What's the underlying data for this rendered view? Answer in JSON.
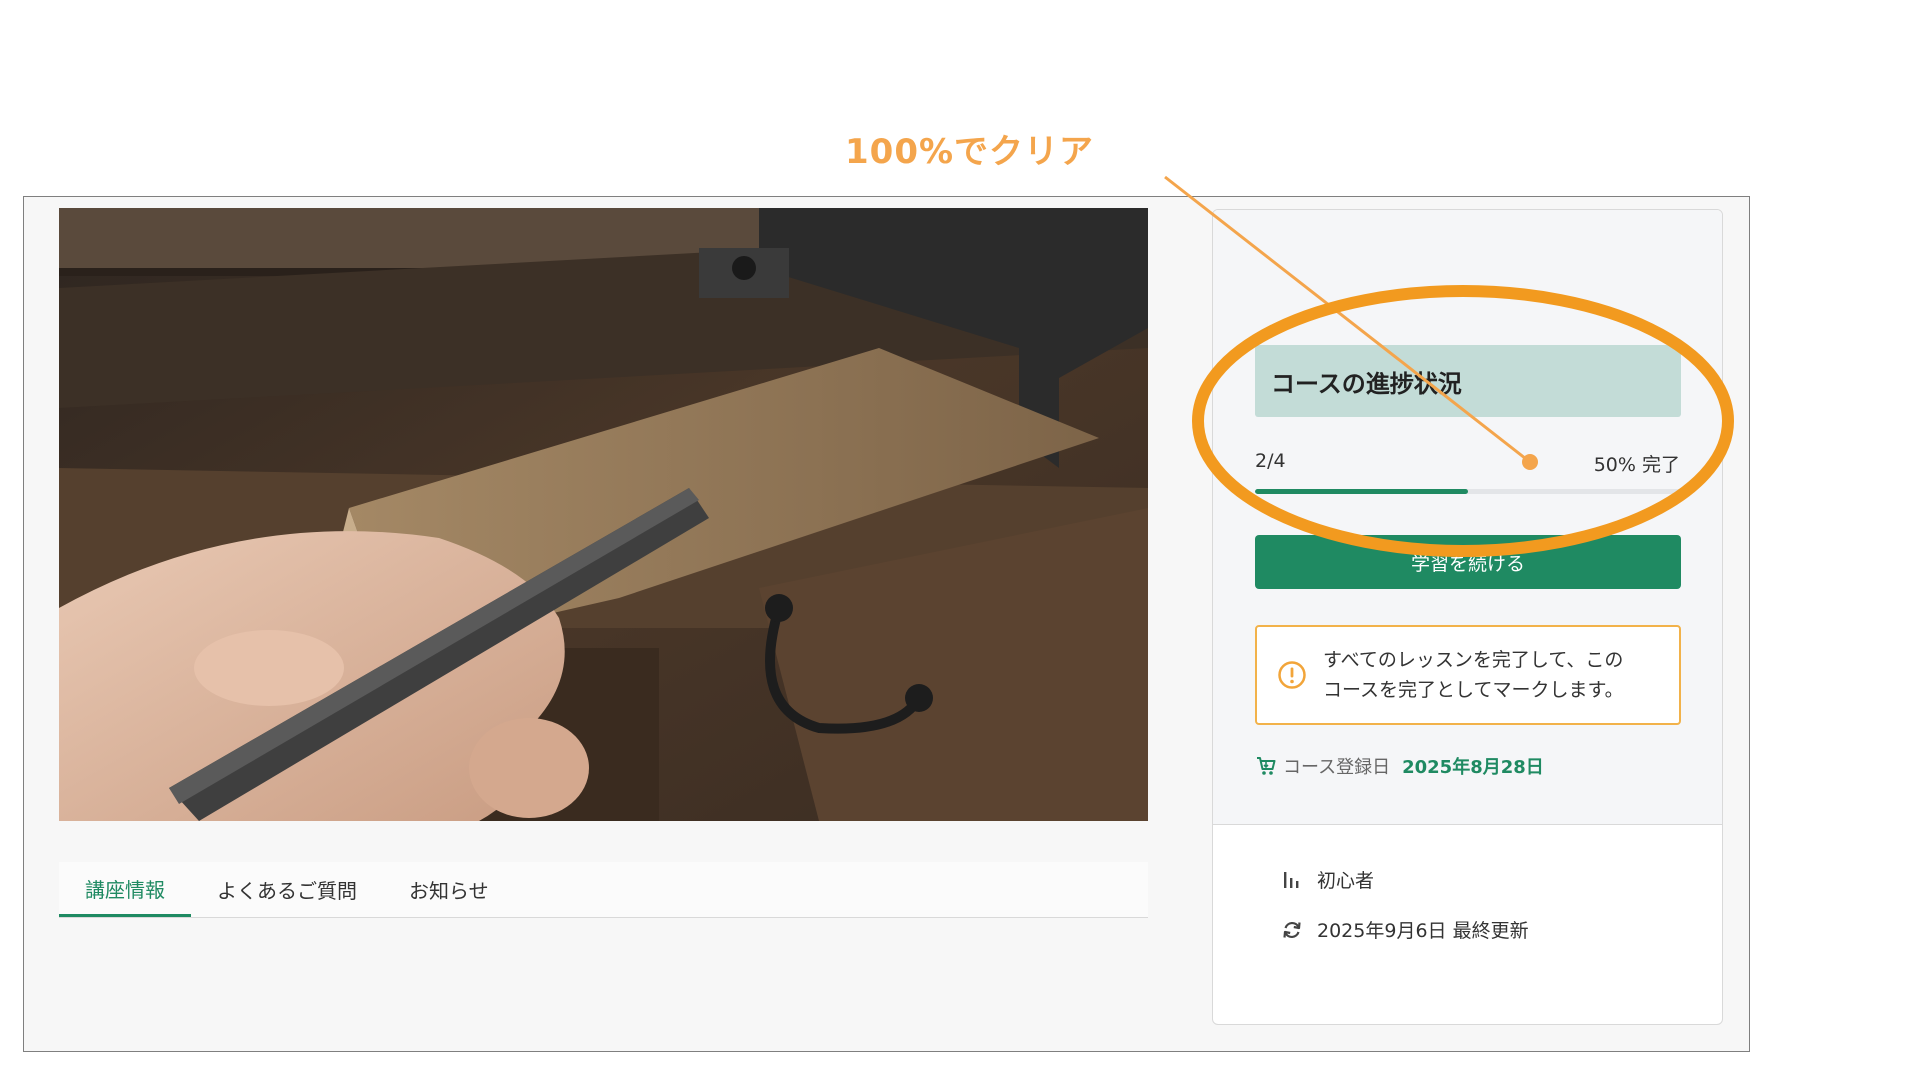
{
  "annotation": {
    "label": "100%でクリア",
    "color": "#f29a1f"
  },
  "media": {
    "description_icon": "wooden-board-file-photo"
  },
  "tabs": [
    {
      "label": "講座情報",
      "active": true
    },
    {
      "label": "よくあるご質問",
      "active": false
    },
    {
      "label": "お知らせ",
      "active": false
    }
  ],
  "sidebar": {
    "progress_title": "コースの進捗状況",
    "progress_count": "2/4",
    "progress_percent_text": "50% 完了",
    "progress_fraction": 0.5,
    "continue_label": "学習を続ける",
    "notice_icon": "warning-circle-icon",
    "notice_text_line1": "すべてのレッスンを完了して、この",
    "notice_text_line2": "コースを完了としてマークします。",
    "enroll_icon": "cart-icon",
    "enroll_label": "コース登録日",
    "enroll_date": "2025年8月28日",
    "level_icon": "bar-chart-icon",
    "level": "初心者",
    "updated_icon": "refresh-icon",
    "updated": "2025年9月6日 最終更新"
  },
  "colors": {
    "accent": "#1f8a62",
    "progress_header_bg": "#c3dcd7",
    "notice_border": "#f2b24a",
    "annotation": "#f29a1f"
  }
}
